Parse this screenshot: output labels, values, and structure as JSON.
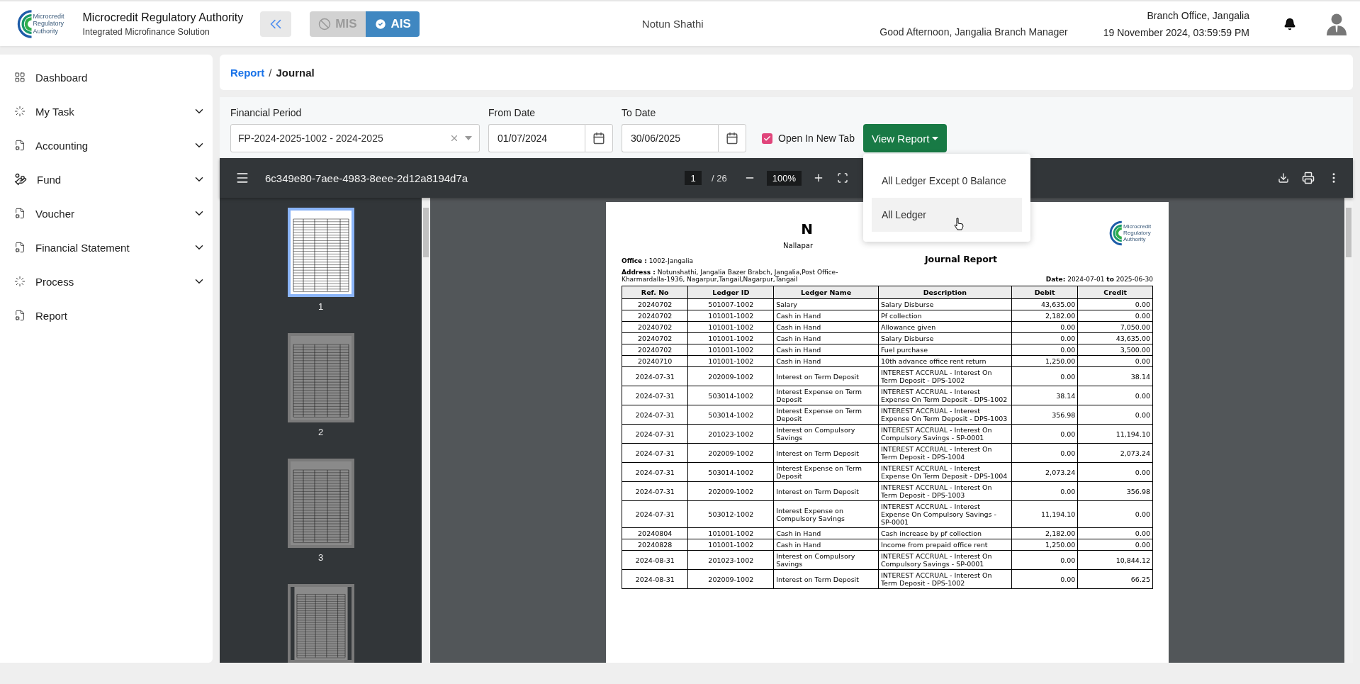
{
  "header": {
    "logo_text": "Microcredit Regulatory Authority",
    "org_name": "Microcredit Regulatory Authority",
    "org_subtitle": "Integrated Microfinance Solution",
    "modes": [
      {
        "label": "MIS",
        "selected": false
      },
      {
        "label": "AIS",
        "selected": true
      }
    ],
    "center_title": "Notun Shathi",
    "greeting": "Good Afternoon, Jangalia Branch Manager",
    "branch": "Branch Office, Jangalia",
    "datetime": "19 November 2024, 03:59:59 PM"
  },
  "sidebar": {
    "items": [
      {
        "label": "Dashboard",
        "kind": "grid",
        "expandable": false
      },
      {
        "label": "My Task",
        "kind": "process",
        "expandable": true
      },
      {
        "label": "Accounting",
        "kind": "document",
        "expandable": true
      },
      {
        "label": "Fund",
        "kind": "hand",
        "expandable": true
      },
      {
        "label": "Voucher",
        "kind": "document",
        "expandable": true
      },
      {
        "label": "Financial Statement",
        "kind": "document",
        "expandable": true
      },
      {
        "label": "Process",
        "kind": "process",
        "expandable": true
      },
      {
        "label": "Report",
        "kind": "document",
        "expandable": false
      }
    ]
  },
  "breadcrumb": {
    "separator": "/",
    "items": [
      {
        "label": "Report",
        "link": true
      },
      {
        "label": "Journal",
        "link": false
      }
    ]
  },
  "filters": {
    "financial_period": {
      "label": "Financial Period",
      "value": "FP-2024-2025-1002 - 2024-2025"
    },
    "from_date": {
      "label": "From Date",
      "value": "01/07/2024"
    },
    "to_date": {
      "label": "To Date",
      "value": "30/06/2025"
    },
    "open_in_new_tab": {
      "label": "Open In New Tab",
      "checked": true
    },
    "view_report": {
      "label": "View Report",
      "expanded": true,
      "menu": [
        {
          "label": "All Ledger Except 0 Balance",
          "selected": false
        },
        {
          "label": "All Ledger",
          "selected": true
        }
      ]
    }
  },
  "viewer": {
    "file_name": "6c349e80-7aee-4983-8eee-2d12a8194d7a",
    "page_current": "1",
    "page_total": "/ 26",
    "zoom": "100%",
    "thumbnails": [
      {
        "label": "1",
        "selected": true
      },
      {
        "label": "2",
        "selected": false
      },
      {
        "label": "3",
        "selected": false
      }
    ],
    "document": {
      "title": "N",
      "subtitle": "Nallapar",
      "logo_text": "Microcredit Regulatory Authority",
      "report_title": "Journal Report",
      "office": "**Office :** 1002-Jangalia",
      "address": "**Address :** Notunshathi, Jangalia Bazer Brabch, Jangalia,Post Office-Kharmardalla-1936, Nagarpur,Tangail,Nagarpur,Tangail",
      "date": "**Date:** 2024-07-01 **to** 2025-06-30",
      "table": {
        "columns": [
          "Ref. No",
          "Ledger ID",
          "Ledger Name",
          "Description",
          "Debit",
          "Credit"
        ],
        "rows": [
          [
            "20240702",
            "501007-1002",
            "Salary",
            "Salary Disburse",
            "43,635.00",
            "0.00"
          ],
          [
            "20240702",
            "101001-1002",
            "Cash in Hand",
            "Pf collection",
            "2,182.00",
            "0.00"
          ],
          [
            "20240702",
            "101001-1002",
            "Cash in Hand",
            "Allowance given",
            "0.00",
            "7,050.00"
          ],
          [
            "20240702",
            "101001-1002",
            "Cash in Hand",
            "Salary Disburse",
            "0.00",
            "43,635.00"
          ],
          [
            "20240702",
            "101001-1002",
            "Cash in Hand",
            "Fuel purchase",
            "0.00",
            "3,500.00"
          ],
          [
            "20240710",
            "101001-1002",
            "Cash in Hand",
            "10th advance office rent return",
            "1,250.00",
            "0.00"
          ],
          [
            "2024-07-31",
            "202009-1002",
            "Interest on Term Deposit",
            "INTEREST ACCRUAL - Interest On Term Deposit - DPS-1002",
            "0.00",
            "38.14"
          ],
          [
            "2024-07-31",
            "503014-1002",
            "Interest Expense on Term Deposit",
            "INTEREST ACCRUAL - Interest Expense On Term Deposit - DPS-1002",
            "38.14",
            "0.00"
          ],
          [
            "2024-07-31",
            "503014-1002",
            "Interest Expense on Term Deposit",
            "INTEREST ACCRUAL - Interest Expense On Term Deposit - DPS-1003",
            "356.98",
            "0.00"
          ],
          [
            "2024-07-31",
            "201023-1002",
            "Interest on Compulsory Savings",
            "INTEREST ACCRUAL - Interest On Compulsory Savings - SP-0001",
            "0.00",
            "11,194.10"
          ],
          [
            "2024-07-31",
            "202009-1002",
            "Interest on Term Deposit",
            "INTEREST ACCRUAL - Interest On Term Deposit - DPS-1004",
            "0.00",
            "2,073.24"
          ],
          [
            "2024-07-31",
            "503014-1002",
            "Interest Expense on Term Deposit",
            "INTEREST ACCRUAL - Interest Expense On Term Deposit - DPS-1004",
            "2,073.24",
            "0.00"
          ],
          [
            "2024-07-31",
            "202009-1002",
            "Interest on Term Deposit",
            "INTEREST ACCRUAL - Interest On Term Deposit - DPS-1003",
            "0.00",
            "356.98"
          ],
          [
            "2024-07-31",
            "503012-1002",
            "Interest Expense on Compulsory Savings",
            "INTEREST ACCRUAL - Interest Expense On Compulsory Savings - SP-0001",
            "11,194.10",
            "0.00"
          ],
          [
            "20240804",
            "101001-1002",
            "Cash in Hand",
            "Cash increase by pf collection",
            "2,182.00",
            "0.00"
          ],
          [
            "20240828",
            "101001-1002",
            "Cash in Hand",
            "Income from prepaid office rent",
            "1,250.00",
            "0.00"
          ],
          [
            "2024-08-31",
            "201023-1002",
            "Interest on Compulsory Savings",
            "INTEREST ACCRUAL - Interest On Compulsory Savings - SP-0001",
            "0.00",
            "10,844.12"
          ],
          [
            "2024-08-31",
            "202009-1002",
            "Interest on Term Deposit",
            "INTEREST ACCRUAL - Interest On Term Deposit - DPS-1002",
            "0.00",
            "66.25"
          ]
        ]
      }
    }
  }
}
